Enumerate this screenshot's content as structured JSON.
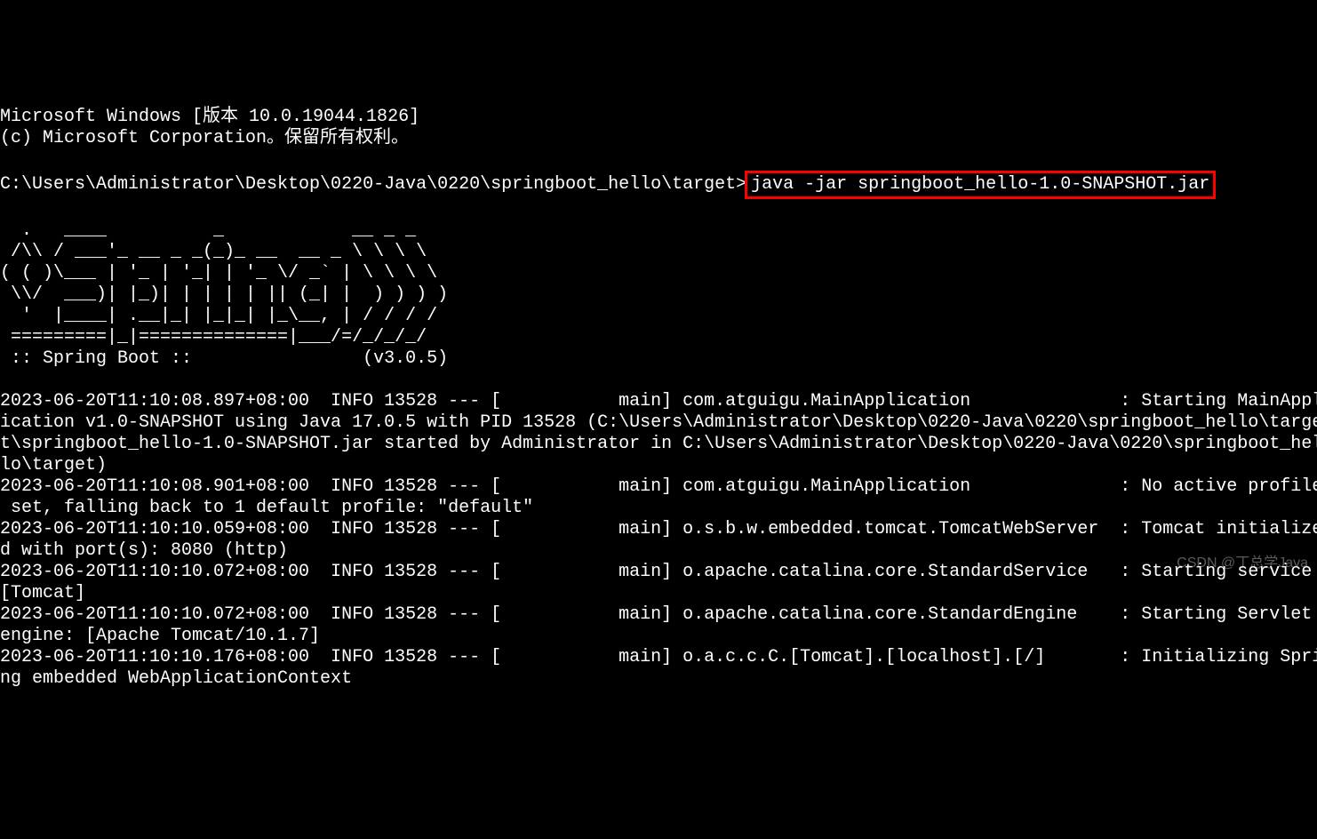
{
  "header": {
    "line1": "Microsoft Windows [版本 10.0.19044.1826]",
    "line2": "(c) Microsoft Corporation。保留所有权利。"
  },
  "prompt": {
    "path": "C:\\Users\\Administrator\\Desktop\\0220-Java\\0220\\springboot_hello\\target>",
    "command": "java -jar springboot_hello-1.0-SNAPSHOT.jar"
  },
  "banner": {
    "l1": "  .   ____          _            __ _ _",
    "l2": " /\\\\ / ___'_ __ _ _(_)_ __  __ _ \\ \\ \\ \\",
    "l3": "( ( )\\___ | '_ | '_| | '_ \\/ _` | \\ \\ \\ \\",
    "l4": " \\\\/  ___)| |_)| | | | | || (_| |  ) ) ) )",
    "l5": "  '  |____| .__|_| |_|_| |_\\__, | / / / /",
    "l6": " =========|_|==============|___/=/_/_/_/",
    "l7": " :: Spring Boot ::                (v3.0.5)"
  },
  "logs": {
    "l1": "2023-06-20T11:10:08.897+08:00  INFO 13528 --- [           main] com.atguigu.MainApplication              : Starting MainAppl",
    "l2": "ication v1.0-SNAPSHOT using Java 17.0.5 with PID 13528 (C:\\Users\\Administrator\\Desktop\\0220-Java\\0220\\springboot_hello\\targe",
    "l3": "t\\springboot_hello-1.0-SNAPSHOT.jar started by Administrator in C:\\Users\\Administrator\\Desktop\\0220-Java\\0220\\springboot_hel",
    "l4": "lo\\target)",
    "l5": "2023-06-20T11:10:08.901+08:00  INFO 13528 --- [           main] com.atguigu.MainApplication              : No active profile",
    "l6": " set, falling back to 1 default profile: \"default\"",
    "l7": "2023-06-20T11:10:10.059+08:00  INFO 13528 --- [           main] o.s.b.w.embedded.tomcat.TomcatWebServer  : Tomcat initialize",
    "l8": "d with port(s): 8080 (http)",
    "l9": "2023-06-20T11:10:10.072+08:00  INFO 13528 --- [           main] o.apache.catalina.core.StandardService   : Starting service ",
    "l10": "[Tomcat]",
    "l11": "2023-06-20T11:10:10.072+08:00  INFO 13528 --- [           main] o.apache.catalina.core.StandardEngine    : Starting Servlet ",
    "l12": "engine: [Apache Tomcat/10.1.7]",
    "l13": "2023-06-20T11:10:10.176+08:00  INFO 13528 --- [           main] o.a.c.c.C.[Tomcat].[localhost].[/]       : Initializing Spri",
    "l14": "ng embedded WebApplicationContext"
  },
  "watermark": "CSDN @丁总学Java"
}
